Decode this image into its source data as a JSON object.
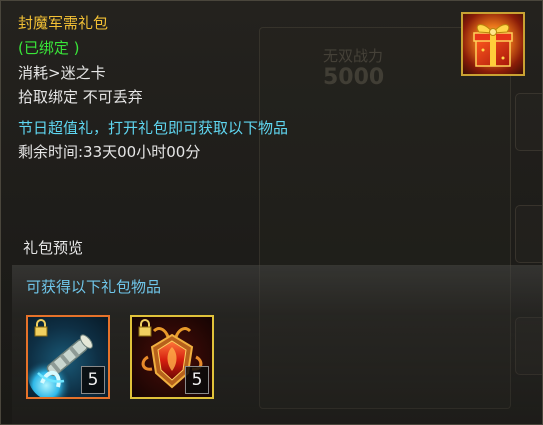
{
  "item": {
    "name": "封魔军需礼包",
    "bound_tag": "(已绑定 )",
    "consume": "消耗>迷之卡",
    "pickup": "拾取绑定 不可丢弃",
    "description": "节日超值礼，打开礼包即可获取以下物品",
    "remaining_time": "剩余时间:33天00小时00分",
    "icon": "gift-box-icon"
  },
  "preview": {
    "title": "礼包预览",
    "subtitle": "可获得以下礼包物品",
    "rewards": [
      {
        "icon": "glowing-scroll-icon",
        "count": "5",
        "locked": true,
        "border_color": "#e5722a"
      },
      {
        "icon": "red-gem-amulet-icon",
        "count": "5",
        "locked": true,
        "border_color": "#e0c23a"
      }
    ]
  },
  "background": {
    "ghost_label": "无双战力",
    "ghost_value": "5000"
  },
  "colors": {
    "name": "#f2c035",
    "bound": "#39e639",
    "description": "#5fd6f0",
    "subtitle": "#6fc6ea",
    "text": "#e6e6e6"
  }
}
